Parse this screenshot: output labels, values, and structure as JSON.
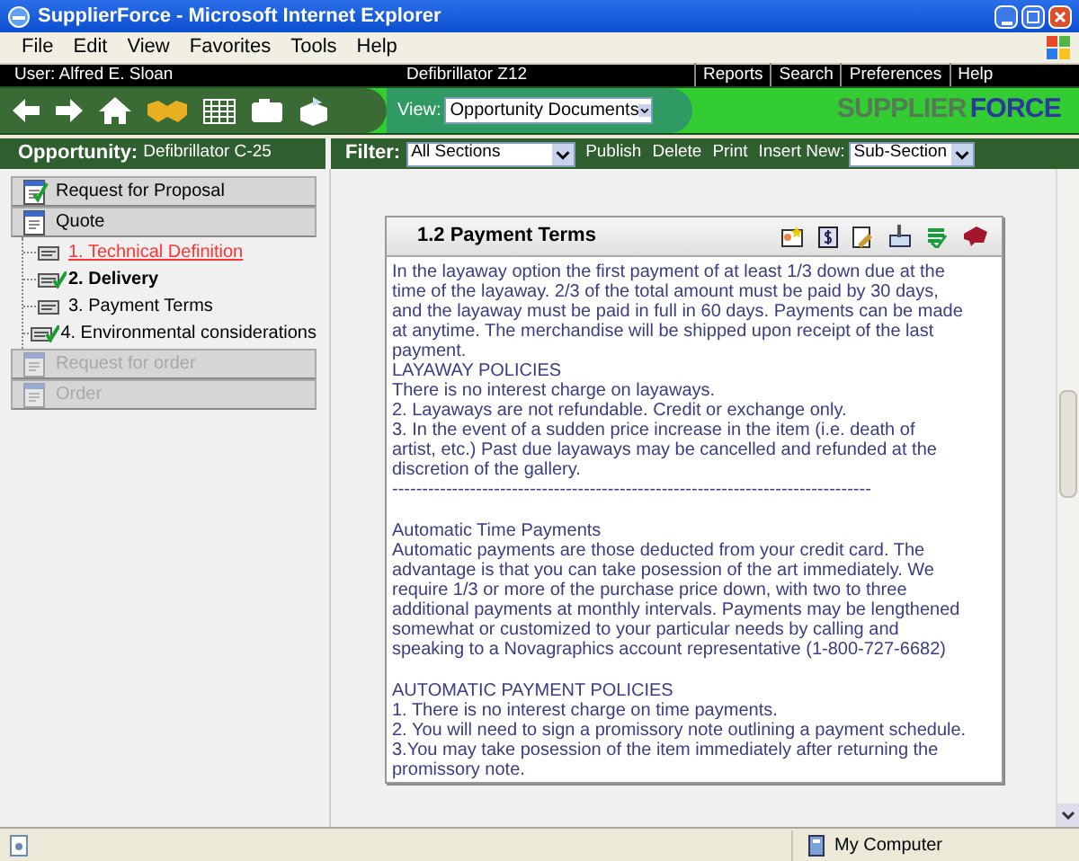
{
  "window": {
    "title": "SupplierForce - Microsoft Internet Explorer"
  },
  "menu": [
    "File",
    "Edit",
    "View",
    "Favorites",
    "Tools",
    "Help"
  ],
  "user_bar": {
    "user": "User: Alfred E. Sloan",
    "product": "Defibrillator Z12",
    "links": [
      "Reports",
      "Search",
      "Preferences",
      "Help"
    ]
  },
  "toolbar": {
    "view_label": "View:",
    "view_value": "Opportunity Documents",
    "logo_left": "SUPPLIER",
    "logo_right": "FORCE"
  },
  "opportunity": {
    "label": "Opportunity:",
    "value": "Defibrillator C-25"
  },
  "filter": {
    "label": "Filter:",
    "value": "All Sections",
    "actions": [
      "Publish",
      "Delete",
      "Print"
    ],
    "insert_label": "Insert New:",
    "insert_value": "Sub-Section"
  },
  "sidebar": {
    "items": [
      {
        "label": "Request for Proposal",
        "checked": true,
        "disabled": false
      },
      {
        "label": "Quote",
        "checked": false,
        "disabled": false,
        "children": [
          {
            "label": "1. Technical Definition",
            "checked": false,
            "selected": false,
            "flagged": true
          },
          {
            "label": "2. Delivery",
            "checked": true,
            "selected": true,
            "flagged": false
          },
          {
            "label": "3. Payment Terms",
            "checked": false,
            "selected": false,
            "flagged": false
          },
          {
            "label": "4. Environmental considerations",
            "checked": true,
            "selected": false,
            "flagged": false
          }
        ]
      },
      {
        "label": "Request for order",
        "checked": false,
        "disabled": true
      },
      {
        "label": "Order",
        "checked": false,
        "disabled": true
      }
    ]
  },
  "document": {
    "title": "1.2 Payment Terms",
    "sections": [
      [
        "In the layaway option the first payment of at least 1/3 down due at the\ntime of the layaway. 2/3 of the total amount must be paid by 30 days,\nand the layaway must be paid in full in 60 days. Payments can be made\nat anytime. The merchandise will be shipped upon receipt of the last\npayment.",
        "LAYAWAY POLICIES",
        "There is no interest charge on layaways.",
        "2. Layaways are not refundable. Credit or exchange only.",
        "3. In the event of a sudden price increase in the item (i.e. death of\nartist, etc.) Past due layaways may be cancelled and refunded at the\ndiscretion of the gallery.",
        "--------------------------------------------------------------------------------"
      ],
      [
        "Automatic Time Payments",
        "Automatic payments are those deducted from your credit card. The\nadvantage is that you can take posession of the art immediately. We\nrequire 1/3 or more of the purchase price down, with two to three\nadditional payments at monthly intervals. Payments may be lengthened\nsomewhat or customized to your particular needs by calling and\nspeaking to a Novagraphics account representative (1-800-727-6682)"
      ],
      [
        "AUTOMATIC PAYMENT POLICIES",
        "1. There is no interest charge on time payments.",
        "2. You will need to sign a promissory note outlining a payment schedule.",
        "3.You may take posession of the item immediately after returning the\npromissory note."
      ]
    ]
  },
  "status_bar": {
    "text": "My Computer"
  }
}
